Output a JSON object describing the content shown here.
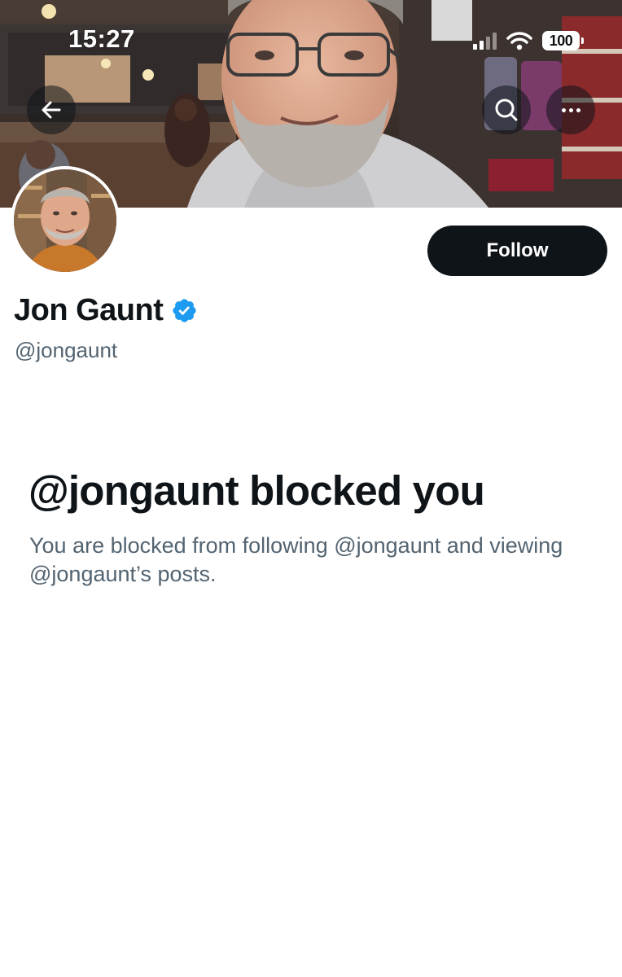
{
  "status_bar": {
    "time": "15:27",
    "battery": "100",
    "icons": [
      "signal-icon",
      "wifi-icon",
      "battery-icon"
    ]
  },
  "header": {
    "icons": [
      "back-arrow-icon",
      "search-icon",
      "more-icon"
    ]
  },
  "profile": {
    "display_name": "Jon Gaunt",
    "handle": "@jongaunt",
    "verified_color": "#1d9bf0",
    "follow_label": "Follow"
  },
  "blocked_notice": {
    "title": "@jongaunt blocked you",
    "description": "You are blocked from following @jongaunt and viewing @jongaunt’s posts."
  },
  "colors": {
    "primary_text": "#0f1419",
    "secondary_text": "#536471",
    "button_bg": "#0f1419",
    "accent": "#1d9bf0"
  }
}
